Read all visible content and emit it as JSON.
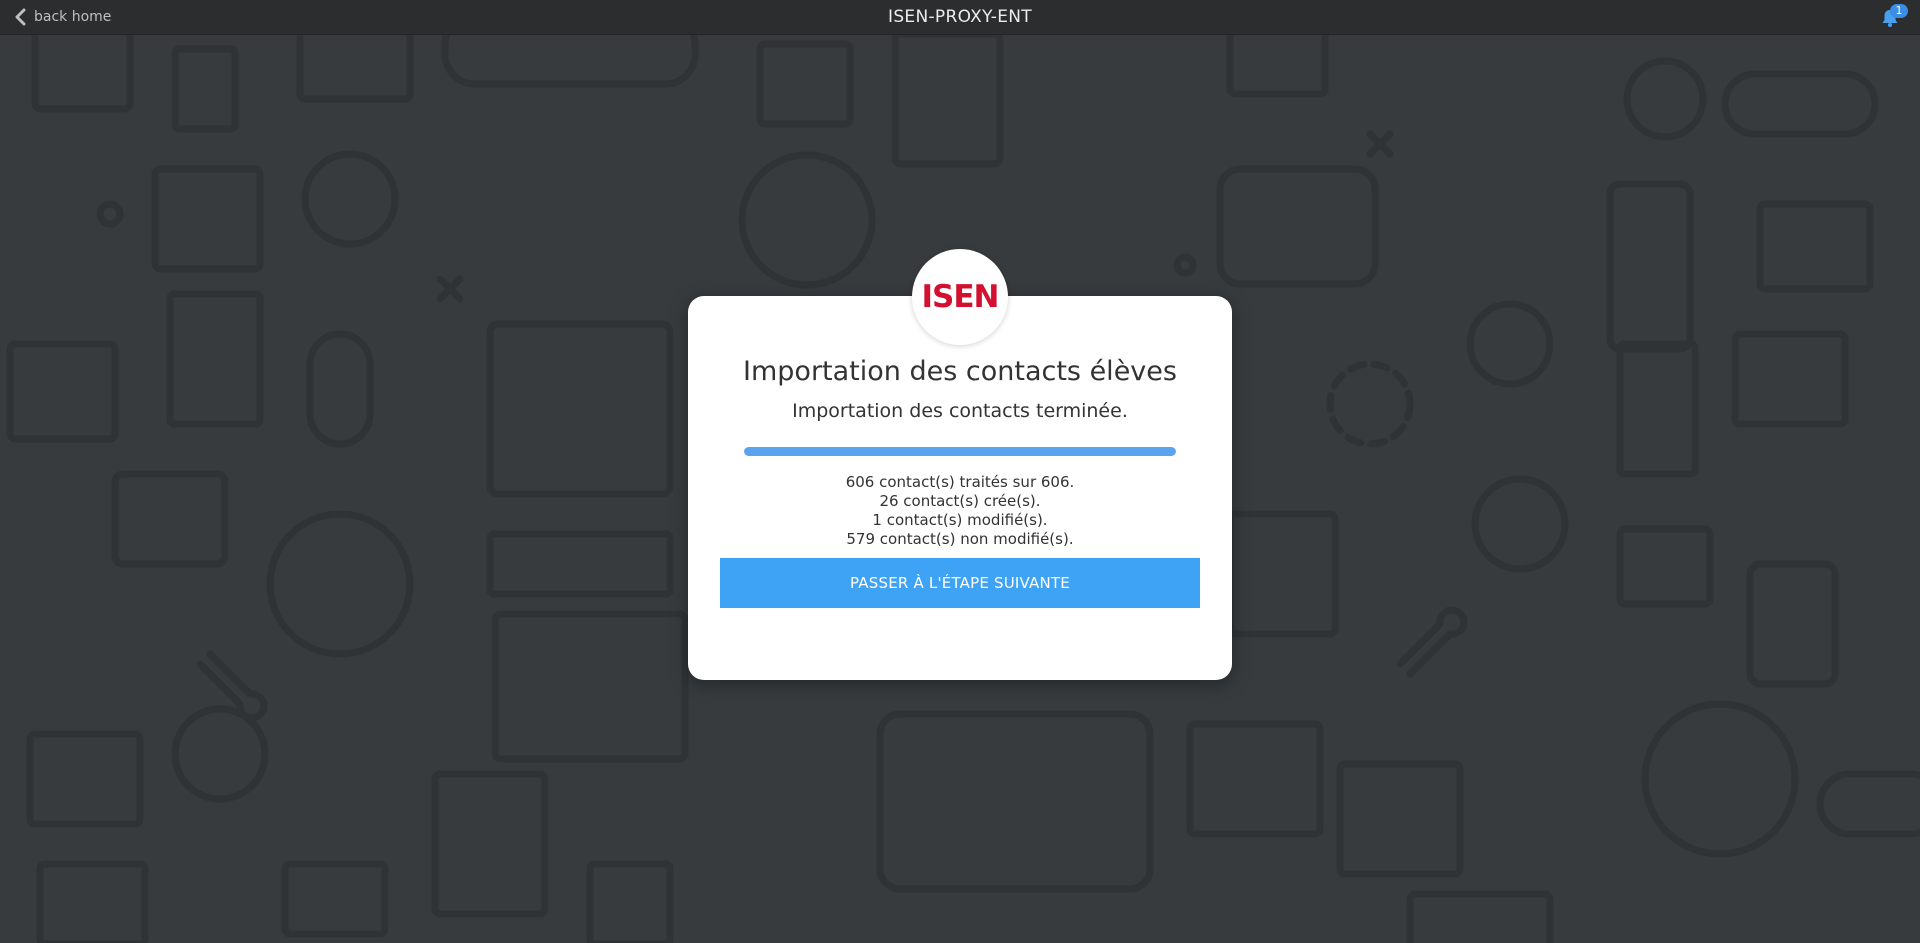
{
  "topbar": {
    "back_label": "back home",
    "title": "ISEN-PROXY-ENT",
    "notification_count": "1",
    "icons": {
      "back": "chevron-left-icon",
      "notifications": "bell-icon"
    }
  },
  "modal": {
    "logo_text": "ISEN",
    "title": "Importation des contacts élèves",
    "subtitle": "Importation des contacts terminée.",
    "progress_fraction": 1.0,
    "stats": [
      "606 contact(s) traités sur 606.",
      "26 contact(s) crée(s).",
      "1 contact(s) modifié(s).",
      "579 contact(s) non modifié(s)."
    ],
    "next_button_label": "PASSER À L'ÉTAPE SUIVANTE"
  },
  "colors": {
    "background": "#373b3e",
    "topbar": "#2b2d2f",
    "accent": "#3ea3f5",
    "progress": "#5aa3ef",
    "brand": "#d3102f"
  }
}
